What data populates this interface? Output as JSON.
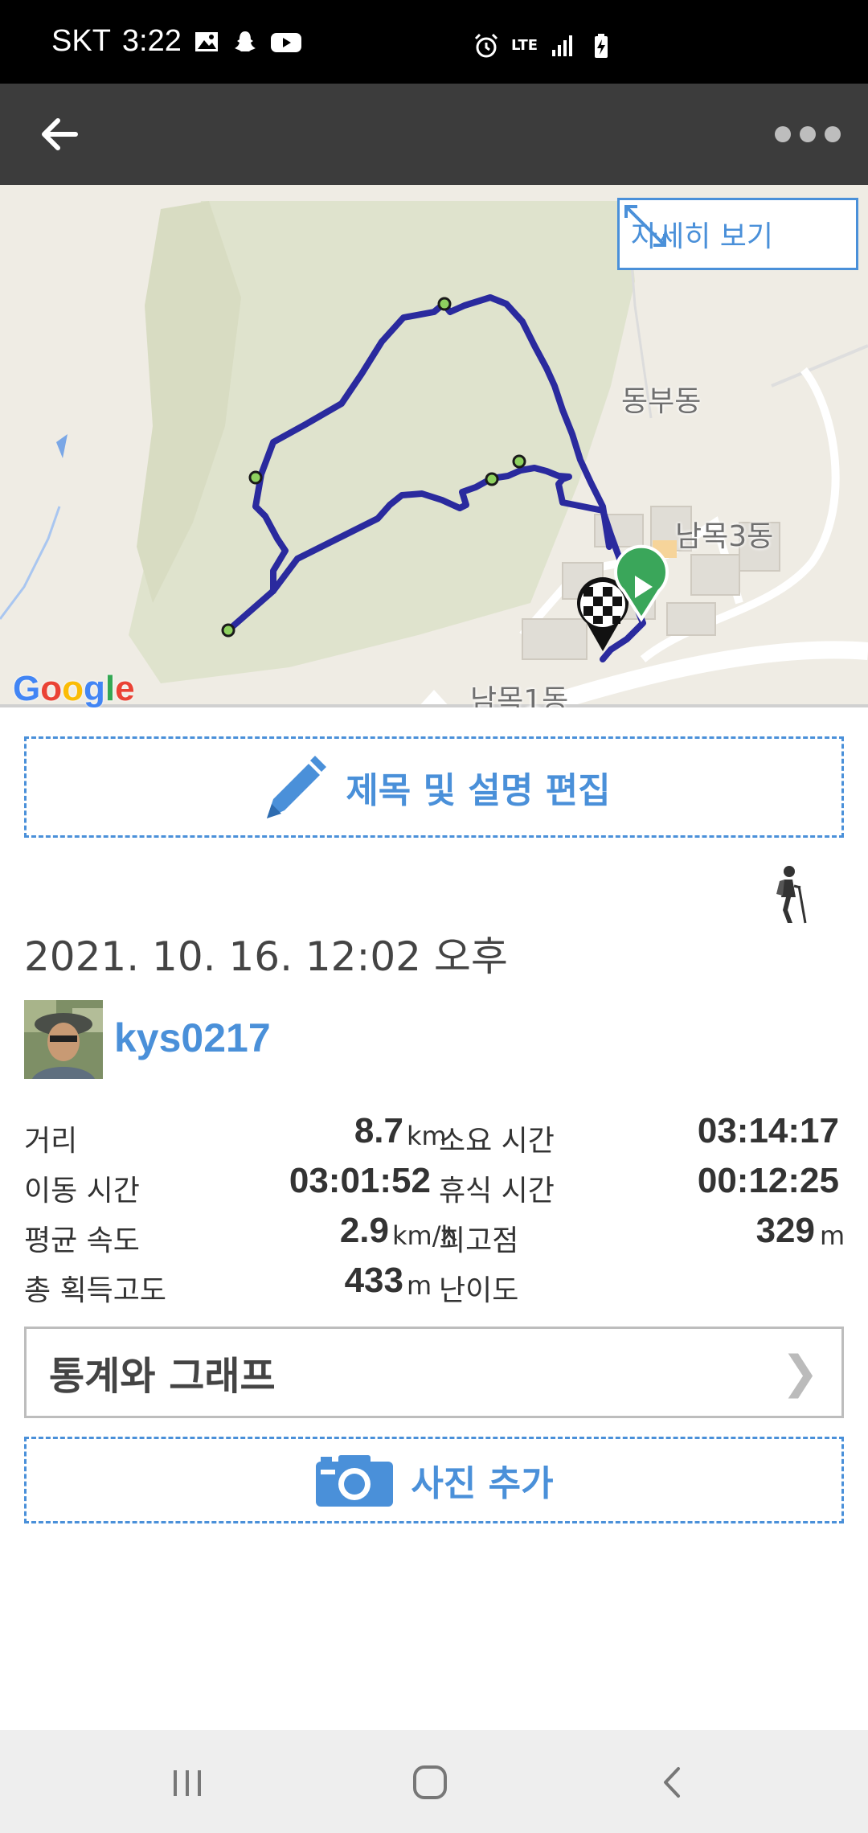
{
  "status_bar": {
    "carrier": "SKT",
    "time": "3:22",
    "network": "LTE"
  },
  "app_bar": {
    "back_icon": "arrow-left-icon",
    "more_icon": "more-dots-icon"
  },
  "map": {
    "detail_button_label": "자세히 보기",
    "labels": [
      "동부동",
      "남목3동",
      "남목1동"
    ],
    "attribution": "Google",
    "route_color": "#2a2a9e",
    "start_marker_color": "#3aa65a"
  },
  "edit_button": {
    "label": "제목 및 설명 편집",
    "icon": "pencil-icon"
  },
  "activity_icon": "hiker-icon",
  "date": "2021. 10. 16. 12:02 오후",
  "user": {
    "name": "kys0217"
  },
  "stats": [
    {
      "label": "거리",
      "value": "8.7",
      "unit": "km"
    },
    {
      "label": "소요 시간",
      "value": "03:14:17",
      "unit": ""
    },
    {
      "label": "이동 시간",
      "value": "03:01:52",
      "unit": ""
    },
    {
      "label": "휴식 시간",
      "value": "00:12:25",
      "unit": ""
    },
    {
      "label": "평균 속도",
      "value": "2.9",
      "unit": "km/h"
    },
    {
      "label": "최고점",
      "value": "329",
      "unit": "m"
    },
    {
      "label": "총 획득고도",
      "value": "433",
      "unit": "m"
    },
    {
      "label": "난이도",
      "value": "",
      "unit": ""
    }
  ],
  "graph_button": {
    "label": "통계와 그래프",
    "chevron": "❯"
  },
  "photo_button": {
    "label": "사진 추가",
    "icon": "camera-icon"
  },
  "nav": {
    "recents_icon": "recents-icon",
    "home_icon": "home-icon",
    "back_icon": "nav-back-icon"
  },
  "colors": {
    "accent": "#4a90d9",
    "app_bar": "#3c3c3c"
  }
}
